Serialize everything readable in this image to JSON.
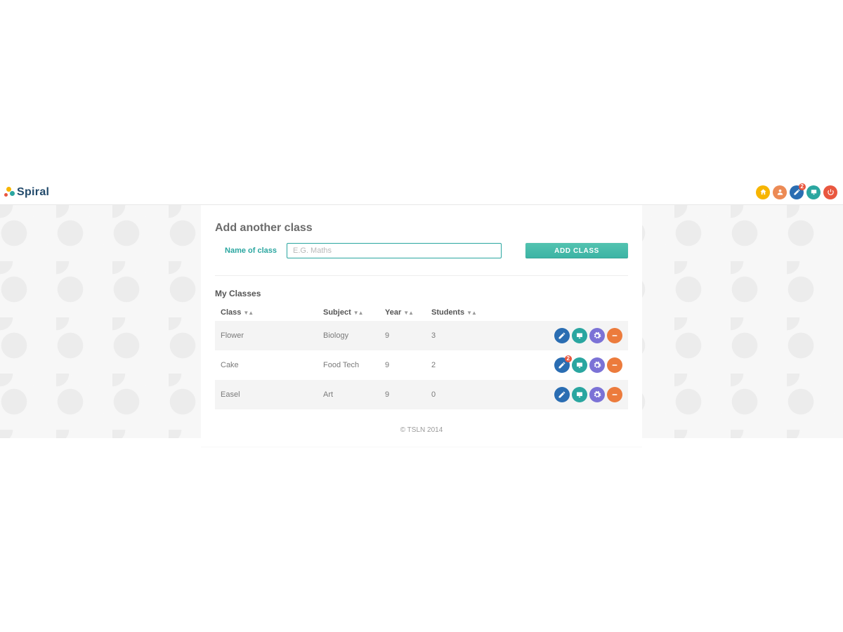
{
  "brand": {
    "name": "Spiral"
  },
  "header": {
    "notifications_badge": "2",
    "icons": [
      "home",
      "user",
      "pencil",
      "quiz",
      "power"
    ]
  },
  "add_class": {
    "heading": "Add another class",
    "label": "Name of class",
    "placeholder": "E.G. Maths",
    "button": "ADD CLASS"
  },
  "my_classes": {
    "heading": "My Classes",
    "columns": {
      "class": "Class",
      "subject": "Subject",
      "year": "Year",
      "students": "Students"
    },
    "sort_glyph": "▼▲",
    "rows": [
      {
        "class": "Flower",
        "subject": "Biology",
        "year": "9",
        "students": "3",
        "badge": null
      },
      {
        "class": "Cake",
        "subject": "Food Tech",
        "year": "9",
        "students": "2",
        "badge": "2"
      },
      {
        "class": "Easel",
        "subject": "Art",
        "year": "9",
        "students": "0",
        "badge": null
      }
    ]
  },
  "footer": {
    "copyright": "© TSLN 2014"
  }
}
